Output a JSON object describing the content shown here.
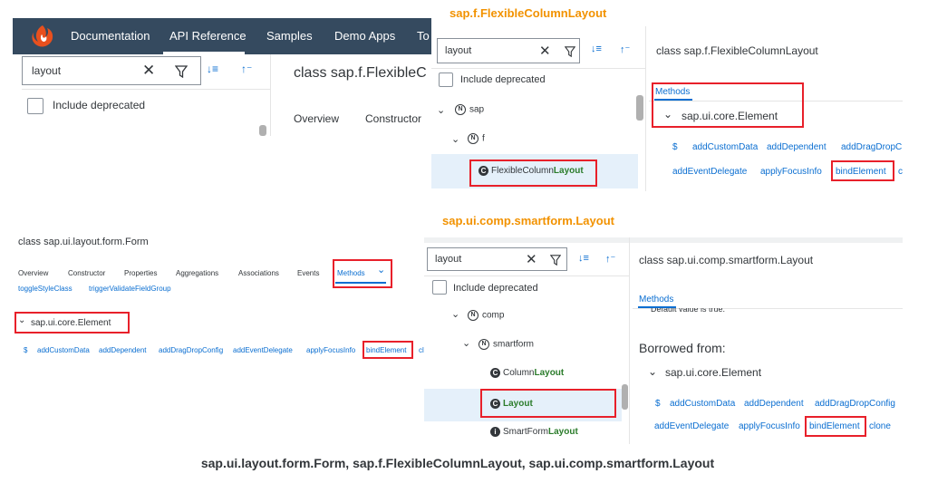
{
  "p1": {
    "nav": [
      "Documentation",
      "API Reference",
      "Samples",
      "Demo Apps",
      "To"
    ],
    "search_value": "layout",
    "include_deprecated": "Include deprecated",
    "class_title": "class sap.f.FlexibleC",
    "tabs": [
      "Overview",
      "Constructor"
    ]
  },
  "p2": {
    "heading": "sap.f.FlexibleColumnLayout",
    "search_value": "layout",
    "include_deprecated": "Include deprecated",
    "tree_sap": "sap",
    "tree_f": "f",
    "tree_item_prefix": "FlexibleColumn",
    "tree_item_hl": "Layout",
    "class_title": "class sap.f.FlexibleColumnLayout",
    "methods_tab": "Methods",
    "element_group": "sap.ui.core.Element",
    "methods_row1": [
      "$",
      "addCustomData",
      "addDependent",
      "addDragDropC"
    ],
    "methods_row2": [
      "addEventDelegate",
      "applyFocusInfo",
      "bindElement",
      "c"
    ]
  },
  "p3": {
    "class_title": "class sap.ui.layout.form.Form",
    "tabs": [
      "Overview",
      "Constructor",
      "Properties",
      "Aggregations",
      "Associations",
      "Events",
      "Methods"
    ],
    "top_links": [
      "toggleStyleClass",
      "triggerValidateFieldGroup"
    ],
    "element_group": "sap.ui.core.Element",
    "methods_row": [
      "$",
      "addCustomData",
      "addDependent",
      "addDragDropConfig",
      "addEventDelegate",
      "applyFocusInfo",
      "bindElement",
      "cl"
    ]
  },
  "p4": {
    "heading": "sap.ui.comp.smartform.Layout",
    "search_value": "layout",
    "include_deprecated": "Include deprecated",
    "tree_comp": "comp",
    "tree_smartform": "smartform",
    "item1_prefix": "Column",
    "item1_hl": "Layout",
    "item2_hl": "Layout",
    "item3_prefix": "SmartForm",
    "item3_hl": "Layout",
    "class_title": "class sap.ui.comp.smartform.Layout",
    "methods_tab": "Methods",
    "default_text": "Default value is true.",
    "borrowed": "Borrowed from:",
    "element_group": "sap.ui.core.Element",
    "methods_row1": [
      "$",
      "addCustomData",
      "addDependent",
      "addDragDropConfig"
    ],
    "methods_row2": [
      "addEventDelegate",
      "applyFocusInfo",
      "bindElement",
      "clone"
    ]
  },
  "caption": "sap.ui.layout.form.Form, sap.f.FlexibleColumnLayout, sap.ui.comp.smartform.Layout",
  "colors": {
    "shell": "#354a5f",
    "link": "#0a6ed1",
    "highlight": "#e8202a",
    "heading": "#f29200",
    "selected": "#e5f0fa"
  }
}
